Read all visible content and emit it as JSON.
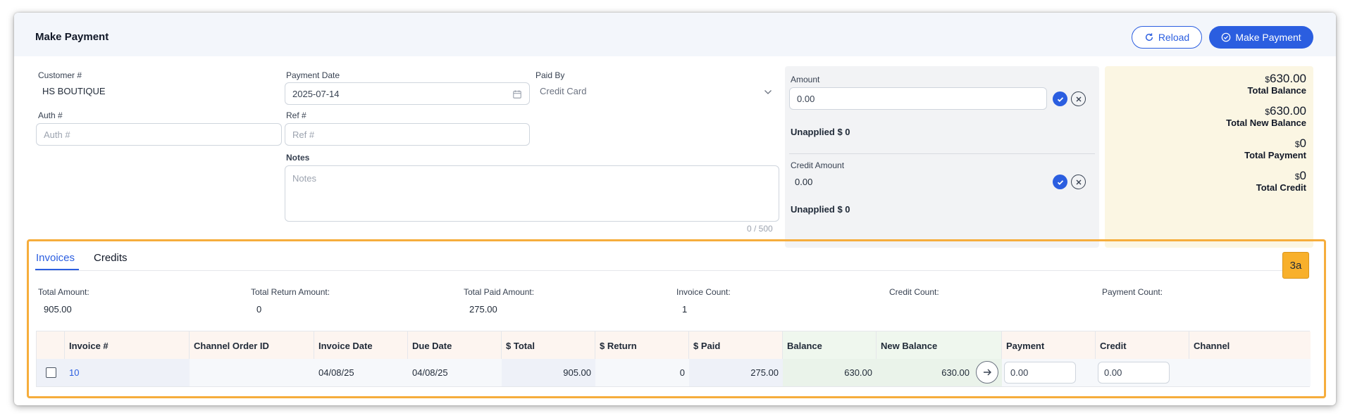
{
  "header": {
    "title": "Make Payment",
    "reload_label": "Reload",
    "make_payment_label": "Make Payment"
  },
  "form": {
    "customer": {
      "label": "Customer #",
      "value": "HS BOUTIQUE"
    },
    "payment_date": {
      "label": "Payment Date",
      "value": "2025-07-14"
    },
    "paid_by": {
      "label": "Paid By",
      "value": "Credit Card"
    },
    "auth": {
      "label": "Auth #",
      "placeholder": "Auth #"
    },
    "ref": {
      "label": "Ref #",
      "placeholder": "Ref #"
    },
    "notes": {
      "label": "Notes",
      "placeholder": "Notes",
      "counter": "0 / 500"
    }
  },
  "amount_panel": {
    "amount_label": "Amount",
    "amount_value": "0.00",
    "unapplied1": "Unapplied   $ 0",
    "credit_label": "Credit Amount",
    "credit_value": "0.00",
    "unapplied2": "Unapplied   $ 0"
  },
  "summary": {
    "currency": "$",
    "items": [
      {
        "amount": "630.00",
        "label": "Total Balance"
      },
      {
        "amount": "630.00",
        "label": "Total New Balance"
      },
      {
        "amount": "0",
        "label": "Total Payment"
      },
      {
        "amount": "0",
        "label": "Total Credit"
      }
    ]
  },
  "tabs": [
    "Invoices",
    "Credits"
  ],
  "badge": "3a",
  "stats": [
    {
      "label": "Total Amount:",
      "value": "905.00"
    },
    {
      "label": "Total Return Amount:",
      "value": "0"
    },
    {
      "label": "Total Paid Amount:",
      "value": "275.00"
    },
    {
      "label": "Invoice Count:",
      "value": "1"
    },
    {
      "label": "Credit Count:",
      "value": ""
    },
    {
      "label": "Payment Count:",
      "value": ""
    }
  ],
  "table": {
    "columns": [
      "",
      "Invoice #",
      "Channel Order ID",
      "Invoice Date",
      "Due Date",
      "$ Total",
      "$ Return",
      "$ Paid",
      "Balance",
      "New Balance",
      "Payment",
      "Credit",
      "Channel"
    ],
    "rows": [
      {
        "invoice": "10",
        "channel_order_id": "",
        "invoice_date": "04/08/25",
        "due_date": "04/08/25",
        "total": "905.00",
        "return": "0",
        "paid": "275.00",
        "balance": "630.00",
        "new_balance": "630.00",
        "payment": "0.00",
        "credit": "0.00",
        "channel": ""
      }
    ]
  },
  "colors": {
    "accent": "#2b5ee0",
    "highlight_border": "#f6ad3c",
    "summary_bg": "#fbf6e3",
    "header_orange": "#fdf5f0",
    "header_green": "#eff7ee"
  }
}
